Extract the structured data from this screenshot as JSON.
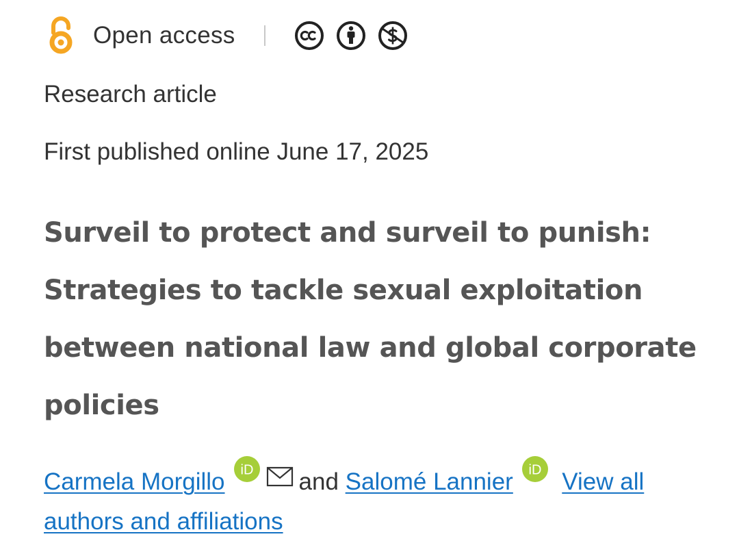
{
  "access": {
    "label": "Open access",
    "icons": [
      "open-access-icon",
      "cc-icon",
      "attribution-icon",
      "noncommercial-icon"
    ],
    "accent_color": "#f5a623"
  },
  "article": {
    "type": "Research article",
    "published": "First published online June 17, 2025",
    "title": "Surveil to protect and surveil to punish: Strategies to tackle sexual exploitation between national law and global corporate policies"
  },
  "authors": {
    "author1": "Carmela Morgillo",
    "connector": "and",
    "author2": "Salomé Lannier",
    "view_all": "View all authors and affiliations",
    "link_color": "#1673c4",
    "orcid_color": "#a6ce39"
  }
}
